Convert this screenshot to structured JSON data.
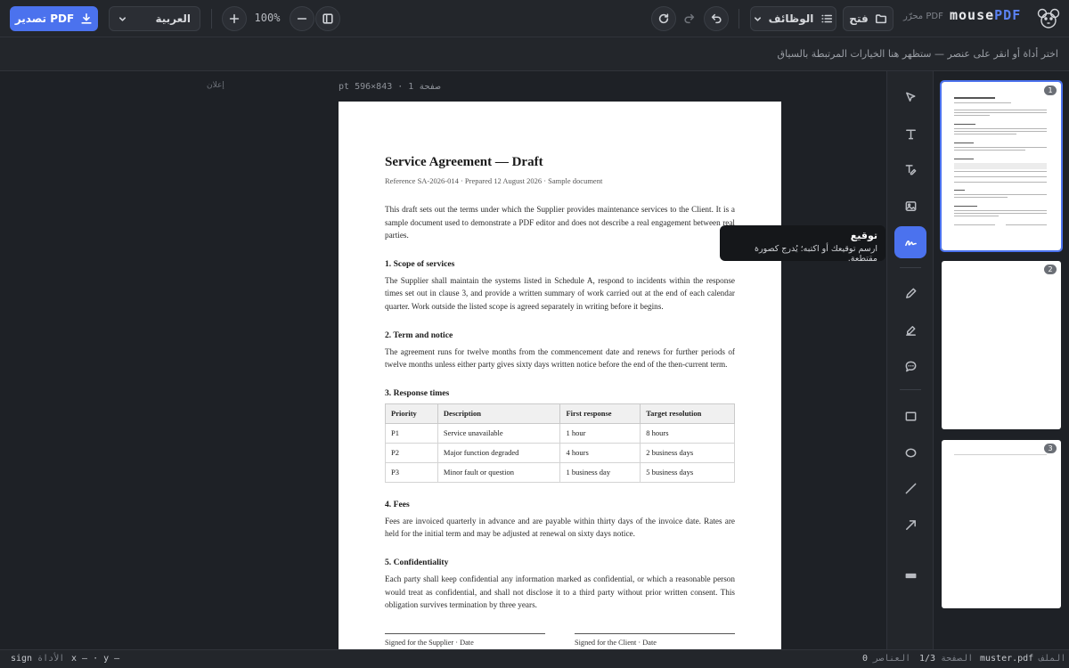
{
  "toolbar": {
    "export_label": "تصدير PDF",
    "language": "العربية",
    "zoom": "100%",
    "features_label": "الوظائف",
    "open_label": "فتح",
    "brand_sub": "محرّر PDF",
    "brand_name_a": "mouse",
    "brand_name_b": "PDF"
  },
  "context_hint": "اختر أداة أو انقر على عنصر — ستظهر هنا الخيارات المرتبطة بالسياق",
  "ad_label": "إعلان",
  "page_info": "صفحة 1 · 843×596 pt",
  "document": {
    "title": "Service Agreement — Draft",
    "reference": "Reference SA-2026-014 · Prepared 12 August 2026 · Sample document",
    "intro": "This draft sets out the terms under which the Supplier provides maintenance services to the Client. It is a sample document used to demonstrate a PDF editor and does not describe a real engagement between real parties.",
    "sections": [
      {
        "heading": "1. Scope of services",
        "body": "The Supplier shall maintain the systems listed in Schedule A, respond to incidents within the response times set out in clause 3, and provide a written summary of work carried out at the end of each calendar quarter. Work outside the listed scope is agreed separately in writing before it begins."
      },
      {
        "heading": "2. Term and notice",
        "body": "The agreement runs for twelve months from the commencement date and renews for further periods of twelve months unless either party gives sixty days written notice before the end of the then-current term."
      },
      {
        "heading": "3. Response times"
      },
      {
        "heading": "4. Fees",
        "body": "Fees are invoiced quarterly in advance and are payable within thirty days of the invoice date. Rates are held for the initial term and may be adjusted at renewal on sixty days notice."
      },
      {
        "heading": "5. Confidentiality",
        "body": "Each party shall keep confidential any information marked as confidential, or which a reasonable person would treat as confidential, and shall not disclose it to a third party without prior written consent. This obligation survives termination by three years."
      }
    ],
    "table": {
      "headers": [
        "Priority",
        "Description",
        "First response",
        "Target resolution"
      ],
      "rows": [
        [
          "P1",
          "Service unavailable",
          "1 hour",
          "8 hours"
        ],
        [
          "P2",
          "Major function degraded",
          "4 hours",
          "2 business days"
        ],
        [
          "P3",
          "Minor fault or question",
          "1 business day",
          "5 business days"
        ]
      ]
    },
    "signatures": [
      "Signed for the Supplier · Date",
      "Signed for the Client · Date"
    ]
  },
  "tooltip": {
    "title": "توقيع",
    "body": "ارسم توقيعك أو اكتبه؛ يُدرج كصورة مقتطعة."
  },
  "tools": [
    "select-icon",
    "text-icon",
    "edit-text-icon",
    "image-icon",
    "signature-icon",
    "pen-icon",
    "highlighter-icon",
    "comment-icon",
    "rectangle-icon",
    "ellipse-icon",
    "line-icon",
    "arrow-icon",
    "redact-icon"
  ],
  "thumbnails": [
    "1",
    "2",
    "3"
  ],
  "status": {
    "file_label": "الملف",
    "file_value": "muster.pdf",
    "page_label": "الصفحة",
    "page_value": "1/3",
    "elements_label": "العناصر",
    "elements_value": "0",
    "tool_label": "الأداة",
    "tool_value": "sign",
    "coords": "x — · y —"
  }
}
